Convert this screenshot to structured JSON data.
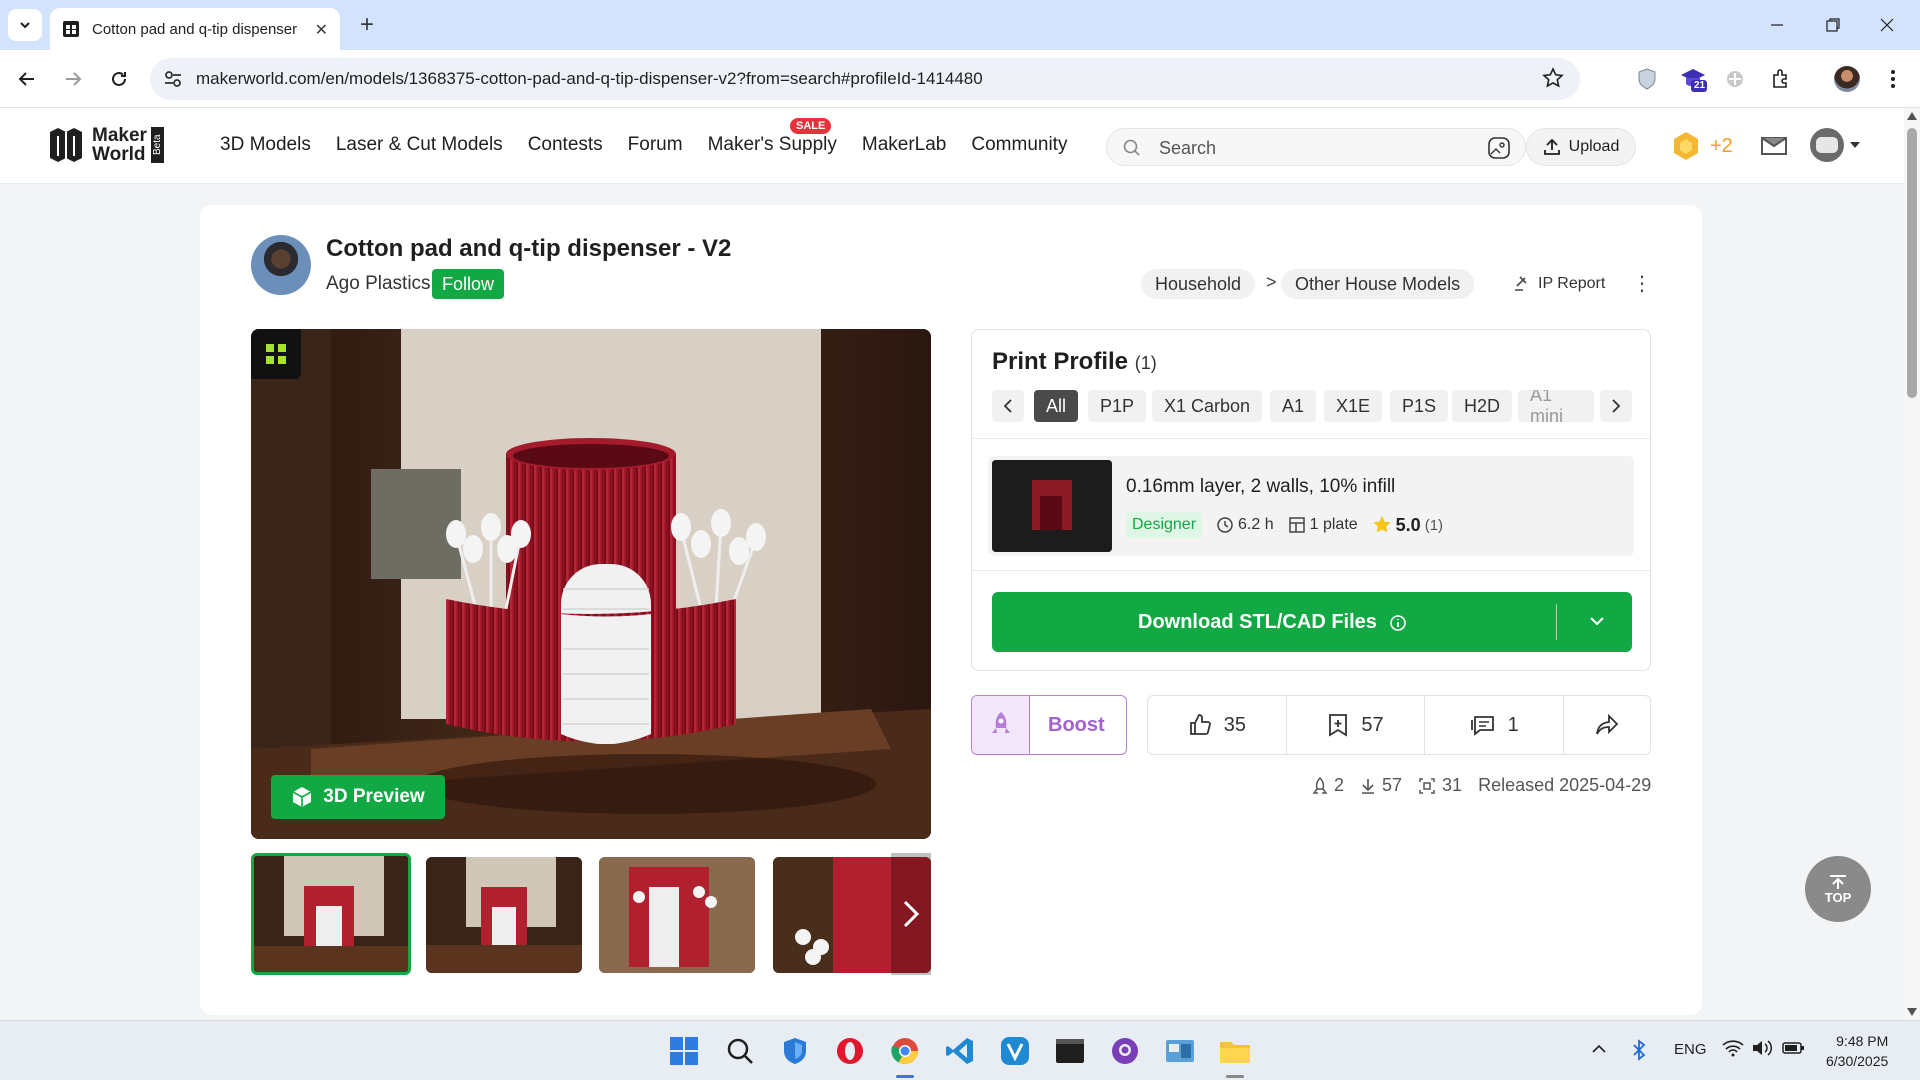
{
  "browser": {
    "tab_title": "Cotton pad and q-tip dispenser",
    "url": "makerworld.com/en/models/1368375-cotton-pad-and-q-tip-dispenser-v2?from=search#profileId-1414480",
    "extension_badge": "21"
  },
  "site": {
    "logo_line1": "Maker",
    "logo_line2": "World",
    "beta": "Beta",
    "nav": [
      "3D Models",
      "Laser & Cut Models",
      "Contests",
      "Forum",
      "Maker's Supply",
      "MakerLab",
      "Community"
    ],
    "sale_badge": "SALE",
    "search_placeholder": "Search",
    "upload_label": "Upload",
    "points": "+2"
  },
  "model": {
    "title": "Cotton pad and q-tip dispenser - V2",
    "designer": "Ago Plastics",
    "follow_label": "Follow",
    "breadcrumb": [
      "Household",
      "Other House Models"
    ],
    "breadcrumb_sep": ">",
    "ip_report": "IP Report",
    "preview_label": "3D Preview"
  },
  "print_profile": {
    "title": "Print Profile",
    "count": "(1)",
    "filters": [
      "All",
      "P1P",
      "X1 Carbon",
      "A1",
      "X1E",
      "P1S",
      "H2D",
      "A1 mini"
    ],
    "active_filter": "All",
    "profile": {
      "name": "0.16mm layer, 2 walls, 10% infill",
      "tag": "Designer",
      "time": "6.2 h",
      "plates": "1 plate",
      "rating": "5.0",
      "rating_count": "(1)"
    },
    "download_label": "Download STL/CAD Files"
  },
  "actions": {
    "boost_label": "Boost",
    "likes": "35",
    "collects": "57",
    "comments": "1"
  },
  "stats": {
    "boosts": "2",
    "downloads": "57",
    "prints": "31",
    "released": "Released 2025-04-29"
  },
  "top_label": "TOP",
  "taskbar": {
    "lang": "ENG",
    "time": "9:48 PM",
    "date": "6/30/2025"
  },
  "colors": {
    "brand_green": "#12a843",
    "boost_purple": "#a461d0",
    "browser_tabbar": "#d3e3fd"
  }
}
